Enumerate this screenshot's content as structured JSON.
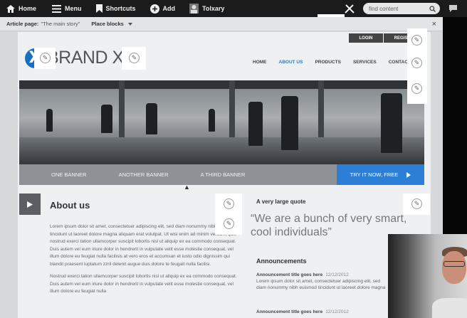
{
  "toolbar": {
    "items": [
      {
        "label": "Home",
        "icon": "home-icon"
      },
      {
        "label": "Menu",
        "icon": "hamburger-icon"
      },
      {
        "label": "Shortcuts",
        "icon": "bookmark-icon"
      },
      {
        "label": "Add",
        "icon": "plus-circle-icon"
      },
      {
        "label": "Tolxary",
        "icon": "user-avatar-icon"
      }
    ],
    "search_placeholder": "find content",
    "edit_icon": "pencil-tools-icon",
    "chat_icon": "chat-bubble-icon"
  },
  "page_bar": {
    "label": "Article page:",
    "value": "\"The main story\"",
    "place_blocks": "Place blocks",
    "close": "×"
  },
  "site": {
    "login": "LOGIN",
    "register": "REGISTER",
    "logo_letter": "X",
    "brand": "BRAND X",
    "nav": [
      "HOME",
      "ABOUT US",
      "PRODUCTS",
      "SERVICES",
      "CONTACT"
    ],
    "banners": [
      "ONE BANNER",
      "ANOTHER BANNER",
      "A THIRD BANNER"
    ],
    "cta": "TRY IT NOW, FREE",
    "about_title": "About us",
    "about_p1": "Lorem ipsum dolor sit amet, consectetuer adipiscing elit, sed diam nonummy nibh euismod tincidunt ut laoreet dolore magna aliquam erat volutpat. Ut wisi enim ad minim veniam, quis nostrud exerci tation ullamcorper suscipit lobortis nisl ut aliquip ex ea commodo consequat. Duis autem vel eum iriure dolor in hendrerit in vulputate velit esse molestie consequat, vel illum dolore eu feugiat nulla facilisis at vero eros et accumsan et iusto odio dignissim qui blandit praesent luptatum zzril delenit augue duis dolore te feugait nulla facilisi.",
    "about_p2": "Nostrud exerci tation ullamcorper suscipit lobortis nisl ut aliquip ex ea commodo consequat. Duis autem vel eum iriure dolor in hendrerit in vulputate velit esse molestie consequat, vel illum dolore eu feugiat nulla",
    "quote_heading": "A very large quote",
    "quote": "“We are a bunch of very smart, cool individuals”",
    "announcements_heading": "Announcements",
    "announcements": [
      {
        "title": "Announcement title goes here",
        "date": "12/12/2012",
        "body": "Lorem ipsum dolor sit amet, consectetuer adipiscing elit, sed diam nonummy nibh euismod tincidunt ut laoreet dolore magna"
      },
      {
        "title": "Announcement title goes here",
        "date": "12/12/2012",
        "body": ""
      }
    ]
  },
  "colors": {
    "accent": "#2c7bc8",
    "cta": "#2d7fd6",
    "toolbar": "#1b1b1b"
  }
}
